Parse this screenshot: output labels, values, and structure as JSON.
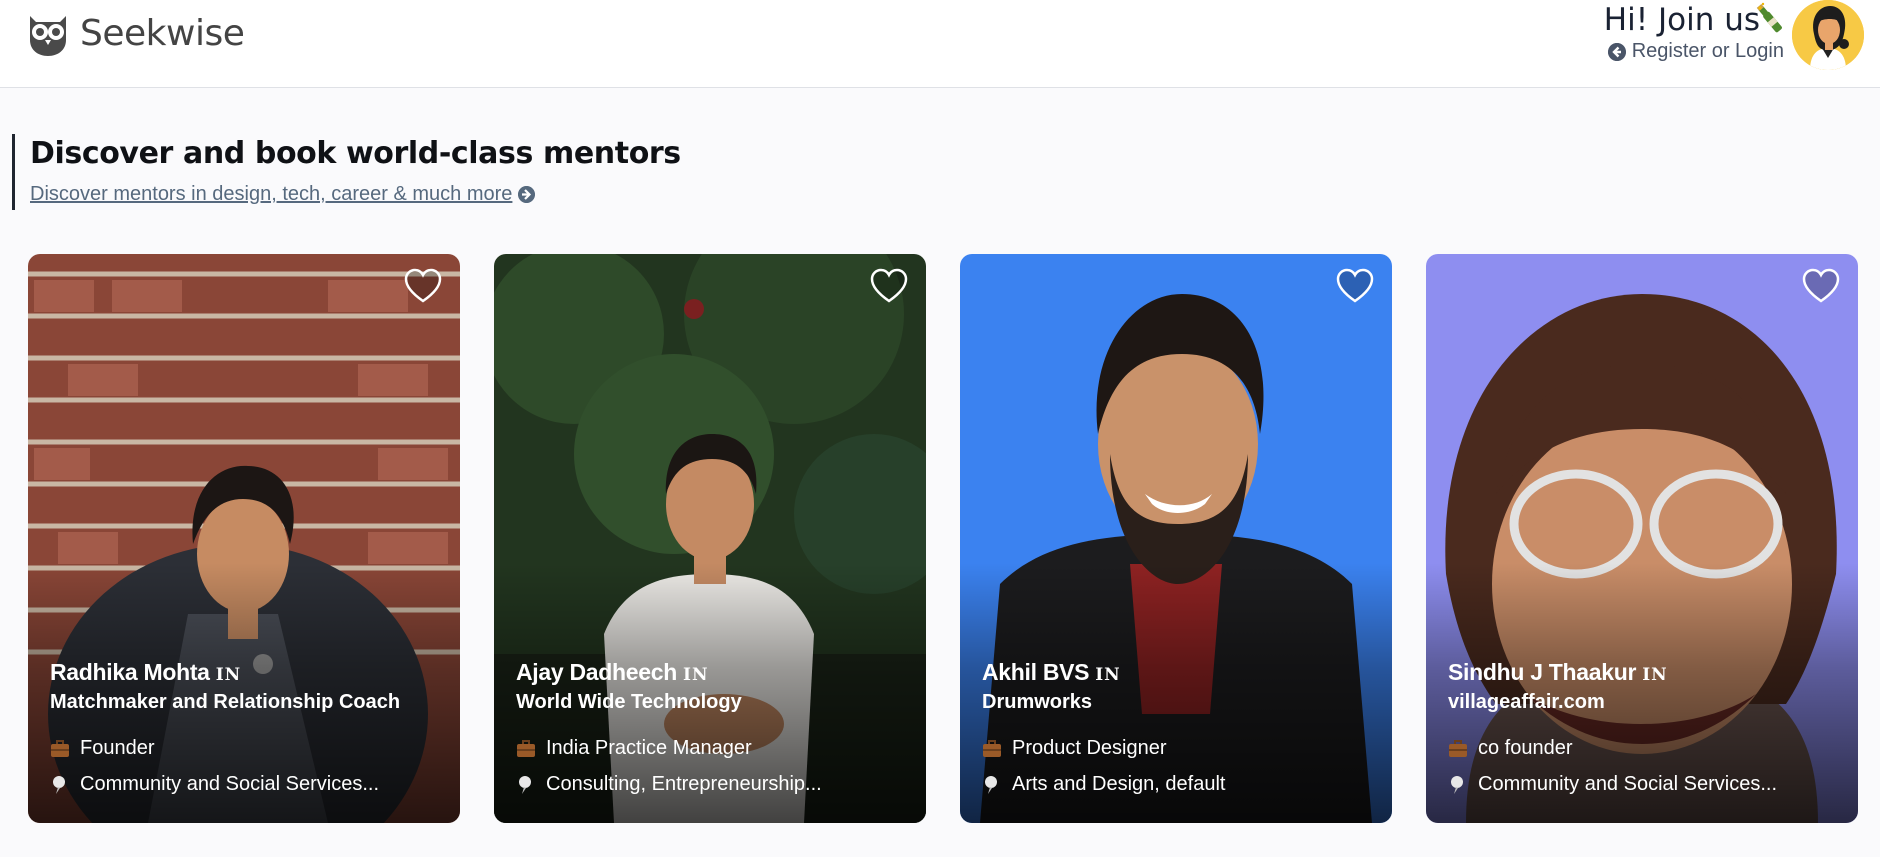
{
  "header": {
    "logo_text": "Seekwise",
    "join_title": "Hi! Join us",
    "login_label": "Register or Login"
  },
  "hero": {
    "title": "Discover and book world-class mentors",
    "link": "Discover mentors in design, tech, career & much more"
  },
  "mentors": [
    {
      "name": "Radhika Mohta",
      "country": "IN",
      "company": "Matchmaker and Relationship Coach",
      "role": "Founder",
      "field": "Community and Social Services..."
    },
    {
      "name": "Ajay Dadheech",
      "country": "IN",
      "company": "World Wide Technology",
      "role": "India Practice Manager",
      "field": "Consulting, Entrepreneurship..."
    },
    {
      "name": "Akhil BVS",
      "country": "IN",
      "company": "Drumworks",
      "role": "Product Designer",
      "field": "Arts and Design, default"
    },
    {
      "name": "Sindhu J Thaakur",
      "country": "IN",
      "company": "villageaffair.com",
      "role": "co founder",
      "field": "Community and Social Services..."
    }
  ],
  "icons": {
    "logo": "owl-icon",
    "join": "bottle-icon",
    "login": "arrow-circle-left-icon",
    "hero_link": "arrow-circle-right-icon",
    "favorite": "heart-icon",
    "role": "briefcase-icon",
    "field": "pin-icon"
  },
  "colors": {
    "accent_text": "#56697e",
    "avatar_bg": "#f7c945",
    "card2_bg": "#3b82f0",
    "card3_bg": "#8e8ef0"
  }
}
